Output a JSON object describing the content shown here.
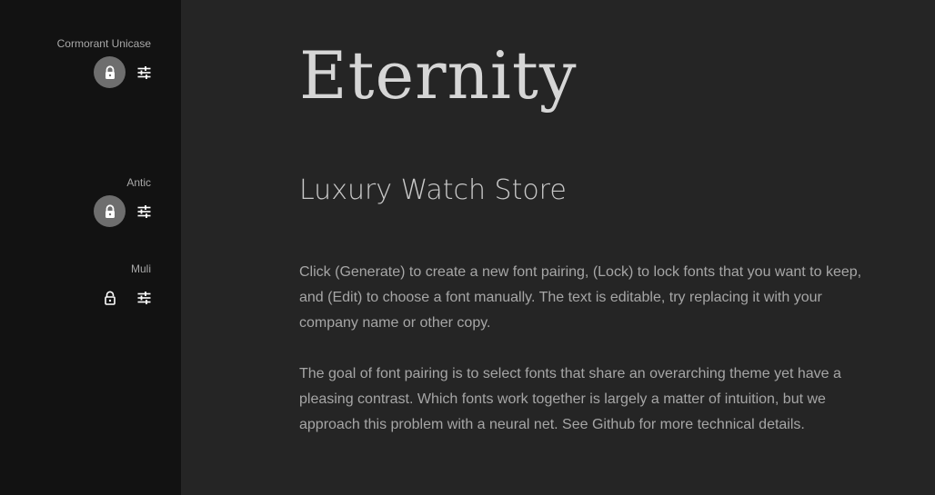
{
  "sidebar": {
    "fonts": [
      {
        "name": "Cormorant Unicase",
        "locked": true,
        "lock_icon": "lock-icon",
        "edit_icon": "sliders-icon"
      },
      {
        "name": "Antic",
        "locked": true,
        "lock_icon": "lock-icon",
        "edit_icon": "sliders-icon"
      },
      {
        "name": "Muli",
        "locked": false,
        "lock_icon": "unlock-icon",
        "edit_icon": "sliders-icon"
      }
    ]
  },
  "main": {
    "heading": "Eternity",
    "subheading": "Luxury Watch Store",
    "paragraphs": [
      "Click (Generate) to create a new font pairing, (Lock) to lock fonts that you want to keep, and (Edit) to choose a font manually. The text is editable, try replacing it with your company name or other copy.",
      "The goal of font pairing is to select fonts that share an overarching theme yet have a pleasing contrast. Which fonts work together is largely a matter of intuition, but we approach this problem with a neural net. See Github for more technical details."
    ]
  },
  "colors": {
    "sidebar_bg": "#121212",
    "main_bg": "#252525",
    "locked_circle": "#6e6e6e",
    "text": "#a6a6a6"
  }
}
